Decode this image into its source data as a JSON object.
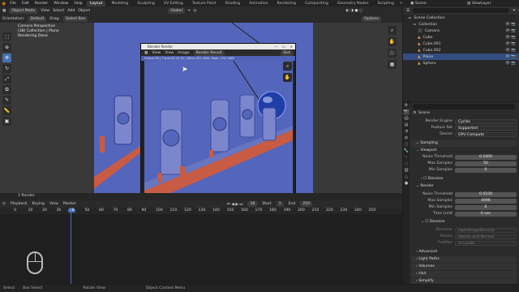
{
  "menu": {
    "items": [
      "File",
      "Edit",
      "Render",
      "Window",
      "Help"
    ],
    "workspaces": [
      "Layout",
      "Modeling",
      "Sculpting",
      "UV Editing",
      "Texture Paint",
      "Shading",
      "Animation",
      "Rendering",
      "Compositing",
      "Geometry Nodes",
      "Scripting"
    ],
    "active_workspace": "Layout",
    "scene": "Scene",
    "view_layer": "ViewLayer"
  },
  "viewport": {
    "mode": "Object Mode",
    "menus": [
      "View",
      "Select",
      "Add",
      "Object"
    ],
    "orientation_label": "Orientation:",
    "orientation_value": "Default",
    "drag_label": "Drag:",
    "drag_value": "Select Box",
    "transform": "Global",
    "options": "Options",
    "info": [
      "Camera Perspective",
      "(38) Collection | Plane",
      "Rendering Done"
    ]
  },
  "render_window": {
    "title": "Blender Render",
    "menus": [
      "View",
      "View",
      "Image"
    ],
    "slot": "Render Result",
    "zoom_btn": "Slot",
    "stats": "Frame:38 | Time:00:15.32 | Mem:431.46M, Peak: 431.46M"
  },
  "timeline": {
    "menus": [
      "Playback",
      "Keying",
      "View",
      "Marker"
    ],
    "current_frame": "38",
    "start_label": "Start",
    "start": "1",
    "end_label": "End",
    "end": "250",
    "ticks": [
      "0",
      "10",
      "20",
      "30",
      "38",
      "50",
      "60",
      "70",
      "80",
      "90",
      "100",
      "110",
      "120",
      "130",
      "140",
      "150",
      "160",
      "170",
      "180",
      "190",
      "200",
      "210",
      "220",
      "230",
      "240",
      "250"
    ],
    "strip_label": "1  Render"
  },
  "statusbar": {
    "items": [
      "Select",
      "Box Select",
      "Rotate View",
      "Object Context Menu"
    ]
  },
  "outliner": {
    "search_placeholder": "",
    "rows": [
      {
        "label": "Scene Collection",
        "icon": "collection-icon",
        "selected": false
      },
      {
        "label": "Collection",
        "icon": "collection-icon",
        "selected": false
      },
      {
        "label": "Camera",
        "icon": "camera-icon",
        "selected": false
      },
      {
        "label": "Cube",
        "icon": "mesh-icon",
        "selected": false
      },
      {
        "label": "Cube.001",
        "icon": "mesh-icon",
        "selected": false
      },
      {
        "label": "Cube.002",
        "icon": "mesh-icon",
        "selected": false
      },
      {
        "label": "Plane",
        "icon": "mesh-icon",
        "selected": true
      },
      {
        "label": "Sphere",
        "icon": "mesh-icon",
        "selected": false
      }
    ]
  },
  "properties": {
    "scene_name": "Scene",
    "render_engine_label": "Render Engine",
    "render_engine": "Cycles",
    "feature_set_label": "Feature Set",
    "feature_set": "Supported",
    "device_label": "Device",
    "device": "GPU Compute",
    "sampling": "Sampling",
    "viewport": "Viewport",
    "vp_noise_label": "Noise Threshold",
    "vp_noise": "0.1000",
    "vp_max_label": "Max Samples",
    "vp_max": "50",
    "vp_min_label": "Min Samples",
    "vp_min": "0",
    "denoise": "Denoise",
    "render": "Render",
    "r_noise_label": "Noise Threshold",
    "r_noise": "0.0100",
    "r_max_label": "Max Samples",
    "r_max": "4096",
    "r_min_label": "Min Samples",
    "r_min": "0",
    "r_time_label": "Time Limit",
    "r_time": "0 sec",
    "denoise2": "Denoise",
    "denoiser_label": "Denoiser",
    "denoiser": "OpenImageDenoise",
    "passes_label": "Passes",
    "passes": "Albedo and Normal",
    "prefilter_label": "Prefilter",
    "prefilter": "Accurate",
    "advanced": "Advanced",
    "light_paths": "Light Paths",
    "volumes": "Volumes",
    "hair": "Hair",
    "simplify": "Simplify"
  },
  "colors": {
    "accent": "#4772b3",
    "scene_blue": "#5162b6",
    "rail_orange": "#d46a4a"
  }
}
